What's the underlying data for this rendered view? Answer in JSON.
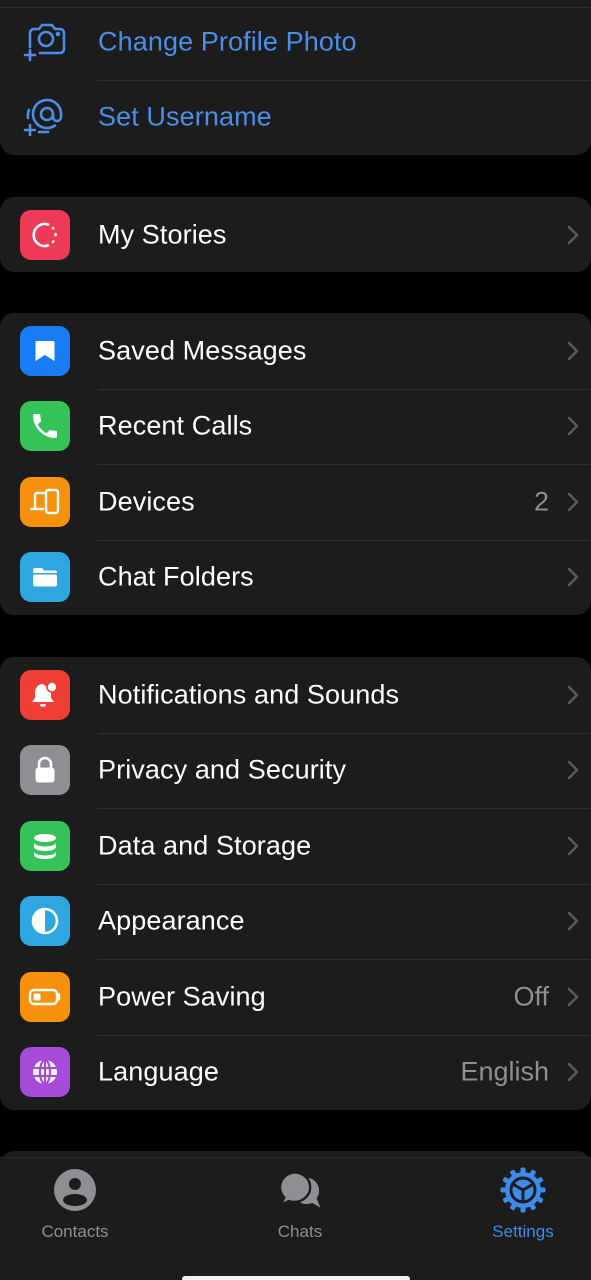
{
  "colors": {
    "background": "#000000",
    "card": "#1c1c1d",
    "accent": "#4a8fe7",
    "secondary_text": "#8e8e93",
    "separator": "#2e2e30"
  },
  "profile_actions": [
    {
      "label": "Change Profile Photo",
      "icon": "camera-add-icon"
    },
    {
      "label": "Set Username",
      "icon": "at-add-icon"
    }
  ],
  "stories_group": [
    {
      "label": "My Stories",
      "icon": "stories-icon",
      "icon_color": "#ee3a57"
    }
  ],
  "chats_group": [
    {
      "label": "Saved Messages",
      "icon": "bookmark-icon",
      "icon_color": "#1a7cf5",
      "value": ""
    },
    {
      "label": "Recent Calls",
      "icon": "phone-icon",
      "icon_color": "#34c259",
      "value": ""
    },
    {
      "label": "Devices",
      "icon": "devices-icon",
      "icon_color": "#f7900c",
      "value": "2"
    },
    {
      "label": "Chat Folders",
      "icon": "folder-icon",
      "icon_color": "#2ea6e0",
      "value": ""
    }
  ],
  "settings_group": [
    {
      "label": "Notifications and Sounds",
      "icon": "bell-icon",
      "icon_color": "#ef3e36",
      "value": ""
    },
    {
      "label": "Privacy and Security",
      "icon": "lock-icon",
      "icon_color": "#8e8e93",
      "value": ""
    },
    {
      "label": "Data and Storage",
      "icon": "database-icon",
      "icon_color": "#34c259",
      "value": ""
    },
    {
      "label": "Appearance",
      "icon": "contrast-icon",
      "icon_color": "#2ea6e0",
      "value": ""
    },
    {
      "label": "Power Saving",
      "icon": "battery-icon",
      "icon_color": "#f7900c",
      "value": "Off"
    },
    {
      "label": "Language",
      "icon": "globe-icon",
      "icon_color": "#a54bd8",
      "value": "English"
    }
  ],
  "tabbar": {
    "tabs": [
      {
        "label": "Contacts",
        "icon": "person-circle-icon",
        "active": false
      },
      {
        "label": "Chats",
        "icon": "chat-bubbles-icon",
        "active": false
      },
      {
        "label": "Settings",
        "icon": "gear-icon",
        "active": true
      }
    ]
  }
}
